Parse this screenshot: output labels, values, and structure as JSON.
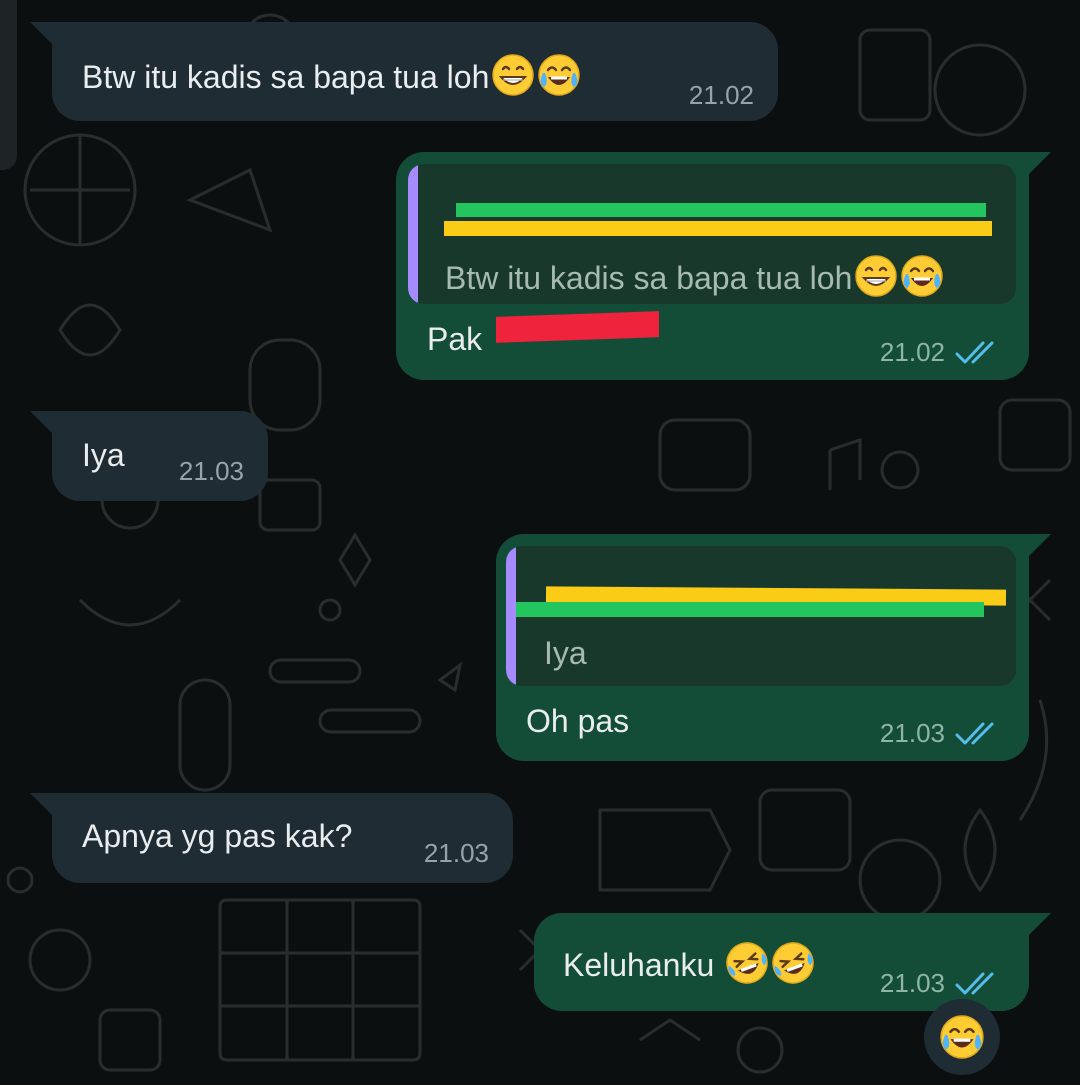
{
  "messages": [
    {
      "id": "m1",
      "direction": "incoming",
      "text": "Btw itu kadis sa bapa tua loh",
      "emojis": [
        "grinning-face",
        "tears-of-joy"
      ],
      "time": "21.02"
    },
    {
      "id": "m2",
      "direction": "outgoing",
      "quote": {
        "text": "Btw itu kadis sa bapa tua loh",
        "emojis": [
          "grinning-face",
          "tears-of-joy"
        ]
      },
      "text": "Pak",
      "time": "21.02",
      "status": "read"
    },
    {
      "id": "m3",
      "direction": "incoming",
      "text": "Iya",
      "time": "21.03"
    },
    {
      "id": "m4",
      "direction": "outgoing",
      "quote": {
        "text": "Iya"
      },
      "text": "Oh pas",
      "time": "21.03",
      "status": "read"
    },
    {
      "id": "m5",
      "direction": "incoming",
      "text": "Apnya yg pas kak?",
      "time": "21.03"
    },
    {
      "id": "m6",
      "direction": "outgoing",
      "text": "Keluhanku",
      "emojis": [
        "rolling-on-floor-laughing",
        "rolling-on-floor-laughing"
      ],
      "time": "21.03",
      "status": "read"
    }
  ],
  "reaction_button": {
    "emoji": "tears-of-joy"
  },
  "colors": {
    "background": "#0b0f10",
    "incoming_bubble": "#1f2c33",
    "outgoing_bubble": "#144d37",
    "quote_background": "#19382c",
    "quote_bar": "#a58bff",
    "read_ticks": "#53bdeb",
    "redaction_green": "#22c55e",
    "redaction_yellow": "#facc15",
    "redaction_red": "#ef233c"
  }
}
